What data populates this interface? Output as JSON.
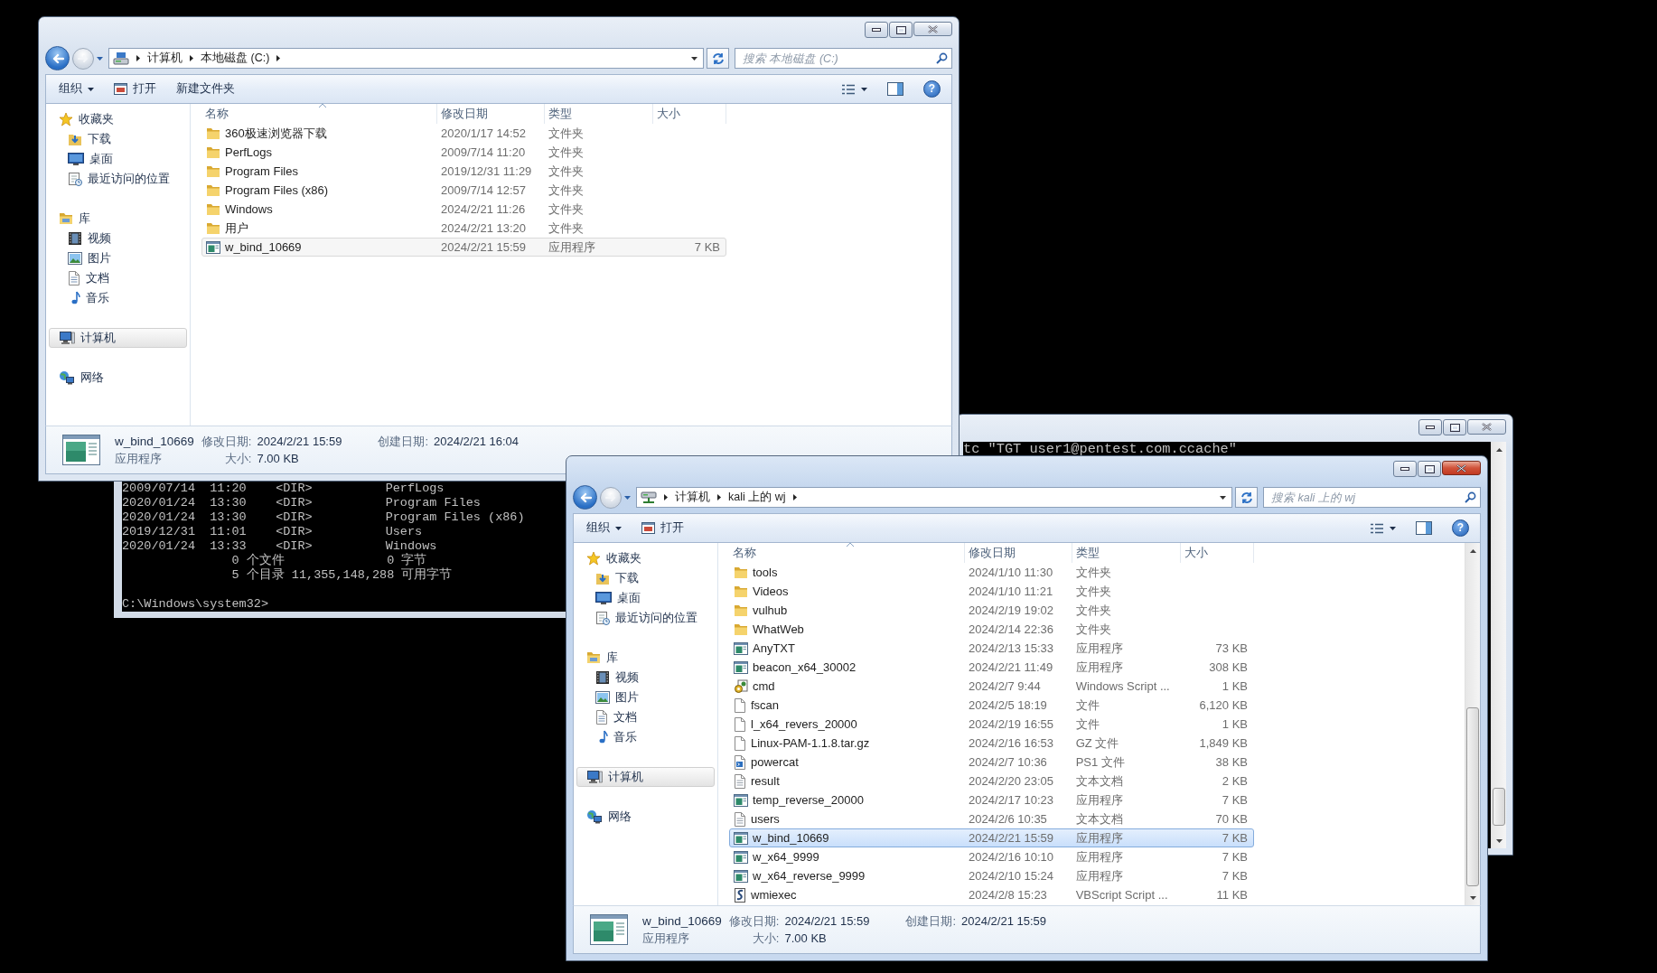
{
  "desktop": {
    "windows": [
      {
        "kind": "explorer",
        "active": false,
        "crumbs": [
          "计算机",
          "本地磁盘 (C:)"
        ],
        "search_placeholder": "搜索 本地磁盘 (C:)",
        "toolbar": [
          {
            "label": "组织",
            "kind": "menu"
          },
          {
            "label": "打开",
            "kind": "open"
          },
          {
            "label": "新建文件夹",
            "kind": "plain"
          }
        ],
        "help": "?",
        "sidebar": [
          {
            "label": "收藏夹",
            "selected": false,
            "children": [
              {
                "label": "下载",
                "selected": false
              },
              {
                "label": "桌面",
                "selected": false
              },
              {
                "label": "最近访问的位置",
                "selected": false
              }
            ]
          },
          {
            "label": "库",
            "selected": false,
            "children": [
              {
                "label": "视频",
                "selected": false
              },
              {
                "label": "图片",
                "selected": false
              },
              {
                "label": "文档",
                "selected": false
              },
              {
                "label": "音乐",
                "selected": false
              }
            ]
          },
          {
            "label": "计算机",
            "selected": true
          },
          {
            "label": "网络",
            "selected": false
          }
        ],
        "columns": [
          "名称",
          "修改日期",
          "类型",
          "大小"
        ],
        "rows": [
          {
            "name": "360极速浏览器下载",
            "date": "2020/1/17 14:52",
            "type": "文件夹",
            "kind": "folder",
            "selected": false
          },
          {
            "name": "PerfLogs",
            "date": "2009/7/14 11:20",
            "type": "文件夹",
            "kind": "folder",
            "selected": false
          },
          {
            "name": "Program Files",
            "date": "2019/12/31 11:29",
            "type": "文件夹",
            "kind": "folder",
            "selected": false
          },
          {
            "name": "Program Files (x86)",
            "date": "2009/7/14 12:57",
            "type": "文件夹",
            "kind": "folder",
            "selected": false
          },
          {
            "name": "Windows",
            "date": "2024/2/21 11:26",
            "type": "文件夹",
            "kind": "folder",
            "selected": false
          },
          {
            "name": "用户",
            "date": "2024/2/21 13:20",
            "type": "文件夹",
            "kind": "folder",
            "selected": false
          },
          {
            "name": "w_bind_10669",
            "date": "2024/2/21 15:59",
            "type": "应用程序",
            "size": "7 KB",
            "kind": "app",
            "selected": true
          }
        ],
        "details": {
          "name": "w_bind_10669",
          "type": "应用程序",
          "fields": [
            {
              "label": "修改日期:",
              "value": "2024/2/21 15:59"
            },
            {
              "label": "创建日期:",
              "value": "2024/2/21 16:04"
            },
            {
              "label": "大小:",
              "value": "7.00 KB"
            }
          ]
        }
      },
      {
        "kind": "console",
        "title_bar": false,
        "lines": [
          "2009/07/14  11:20    <DIR>          PerfLogs",
          "2020/01/24  13:30    <DIR>          Program Files",
          "2020/01/24  13:30    <DIR>          Program Files (x86)",
          "2019/12/31  11:01    <DIR>          Users",
          "2020/01/24  13:33    <DIR>          Windows",
          "               0 个文件              0 字节",
          "               5 个目录 11,355,148,288 可用字节"
        ],
        "prompt": "C:\\Windows\\system32>"
      },
      {
        "kind": "console",
        "title_bar": true,
        "lines": [
          "tc \"TGT user1@pentest.com.ccache\""
        ]
      },
      {
        "kind": "explorer",
        "active": true,
        "crumbs": [
          "计算机",
          "kali 上的 wj"
        ],
        "search_placeholder": "搜索 kali 上的 wj",
        "toolbar": [
          {
            "label": "组织",
            "kind": "menu"
          },
          {
            "label": "打开",
            "kind": "open"
          }
        ],
        "help": "?",
        "sidebar": [
          {
            "label": "收藏夹",
            "selected": false,
            "children": [
              {
                "label": "下载",
                "selected": false
              },
              {
                "label": "桌面",
                "selected": false
              },
              {
                "label": "最近访问的位置",
                "selected": false
              }
            ]
          },
          {
            "label": "库",
            "selected": false,
            "children": [
              {
                "label": "视频",
                "selected": false
              },
              {
                "label": "图片",
                "selected": false
              },
              {
                "label": "文档",
                "selected": false
              },
              {
                "label": "音乐",
                "selected": false
              }
            ]
          },
          {
            "label": "计算机",
            "selected": true
          },
          {
            "label": "网络",
            "selected": false
          }
        ],
        "columns": [
          "名称",
          "修改日期",
          "类型",
          "大小"
        ],
        "rows": [
          {
            "name": "tools",
            "date": "2024/1/10 11:30",
            "type": "文件夹",
            "kind": "folder",
            "selected": false
          },
          {
            "name": "Videos",
            "date": "2024/1/10 11:21",
            "type": "文件夹",
            "kind": "folder",
            "selected": false
          },
          {
            "name": "vulhub",
            "date": "2024/2/19 19:02",
            "type": "文件夹",
            "kind": "folder",
            "selected": false
          },
          {
            "name": "WhatWeb",
            "date": "2024/2/14 22:36",
            "type": "文件夹",
            "kind": "folder",
            "selected": false
          },
          {
            "name": "AnyTXT",
            "date": "2024/2/13 15:33",
            "type": "应用程序",
            "size": "73 KB",
            "kind": "app",
            "selected": false
          },
          {
            "name": "beacon_x64_30002",
            "date": "2024/2/21 11:49",
            "type": "应用程序",
            "size": "308 KB",
            "kind": "app",
            "selected": false
          },
          {
            "name": "cmd",
            "date": "2024/2/7 9:44",
            "type": "Windows Script ...",
            "size": "1 KB",
            "kind": "wsf",
            "selected": false
          },
          {
            "name": "fscan",
            "date": "2024/2/5 18:19",
            "type": "文件",
            "size": "6,120 KB",
            "kind": "file",
            "selected": false
          },
          {
            "name": "l_x64_revers_20000",
            "date": "2024/2/19 16:55",
            "type": "文件",
            "size": "1 KB",
            "kind": "file",
            "selected": false
          },
          {
            "name": "Linux-PAM-1.1.8.tar.gz",
            "date": "2024/2/16 16:53",
            "type": "GZ 文件",
            "size": "1,849 KB",
            "kind": "file",
            "selected": false
          },
          {
            "name": "powercat",
            "date": "2024/2/7 10:36",
            "type": "PS1 文件",
            "size": "38 KB",
            "kind": "ps1",
            "selected": false
          },
          {
            "name": "result",
            "date": "2024/2/20 23:05",
            "type": "文本文档",
            "size": "2 KB",
            "kind": "txt",
            "selected": false
          },
          {
            "name": "temp_reverse_20000",
            "date": "2024/2/17 10:23",
            "type": "应用程序",
            "size": "7 KB",
            "kind": "app",
            "selected": false
          },
          {
            "name": "users",
            "date": "2024/2/6 10:35",
            "type": "文本文档",
            "size": "70 KB",
            "kind": "txt",
            "selected": false
          },
          {
            "name": "w_bind_10669",
            "date": "2024/2/21 15:59",
            "type": "应用程序",
            "size": "7 KB",
            "kind": "app",
            "selected": true
          },
          {
            "name": "w_x64_9999",
            "date": "2024/2/16 10:10",
            "type": "应用程序",
            "size": "7 KB",
            "kind": "app",
            "selected": false
          },
          {
            "name": "w_x64_reverse_9999",
            "date": "2024/2/10 15:24",
            "type": "应用程序",
            "size": "7 KB",
            "kind": "app",
            "selected": false
          },
          {
            "name": "wmiexec",
            "date": "2024/2/8 15:23",
            "type": "VBScript Script ...",
            "size": "11 KB",
            "kind": "vbs",
            "selected": false
          }
        ],
        "details": {
          "name": "w_bind_10669",
          "type": "应用程序",
          "fields": [
            {
              "label": "修改日期:",
              "value": "2024/2/21 15:59"
            },
            {
              "label": "创建日期:",
              "value": "2024/2/21 15:59"
            },
            {
              "label": "大小:",
              "value": "7.00 KB"
            }
          ]
        }
      }
    ]
  }
}
